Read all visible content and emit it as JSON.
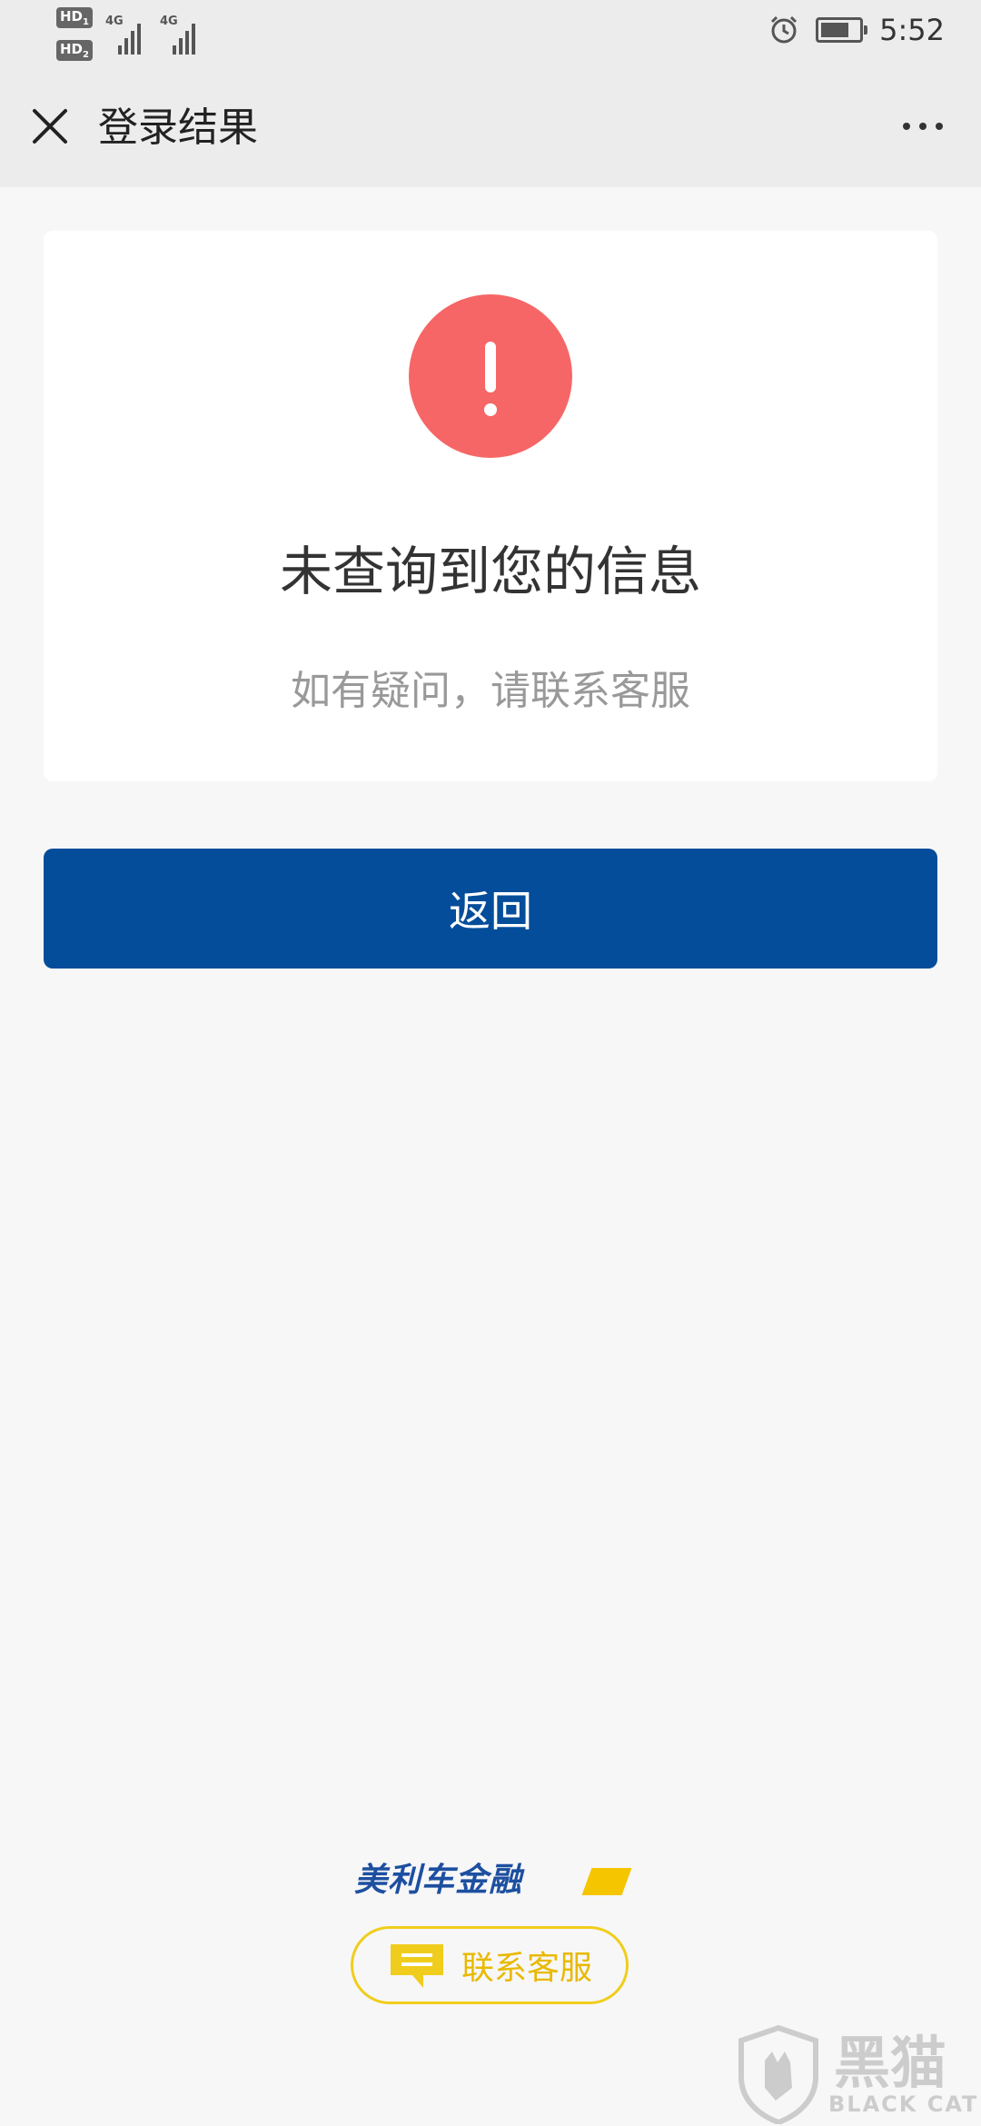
{
  "status_bar": {
    "hd1": "HD",
    "hd2": "HD",
    "net1": "4G",
    "net2": "4G",
    "time": "5:52",
    "icons": [
      "alarm-icon",
      "battery-icon",
      "signal-icon"
    ]
  },
  "title_bar": {
    "title": "登录结果",
    "close_icon": "close-icon",
    "more_icon": "more-icon"
  },
  "result": {
    "icon": "error-exclamation-icon",
    "title": "未查询到您的信息",
    "subtitle": "如有疑问，请联系客服"
  },
  "back_button": {
    "label": "返回"
  },
  "footer": {
    "brand": "美利车金融",
    "contact_label": "联系客服",
    "contact_icon": "chat-bubble-icon"
  },
  "watermark": {
    "cn": "黑猫",
    "en": "BLACK CAT"
  },
  "colors": {
    "primary": "#044d9a",
    "error": "#f66666",
    "accent": "#f0cd1c"
  }
}
